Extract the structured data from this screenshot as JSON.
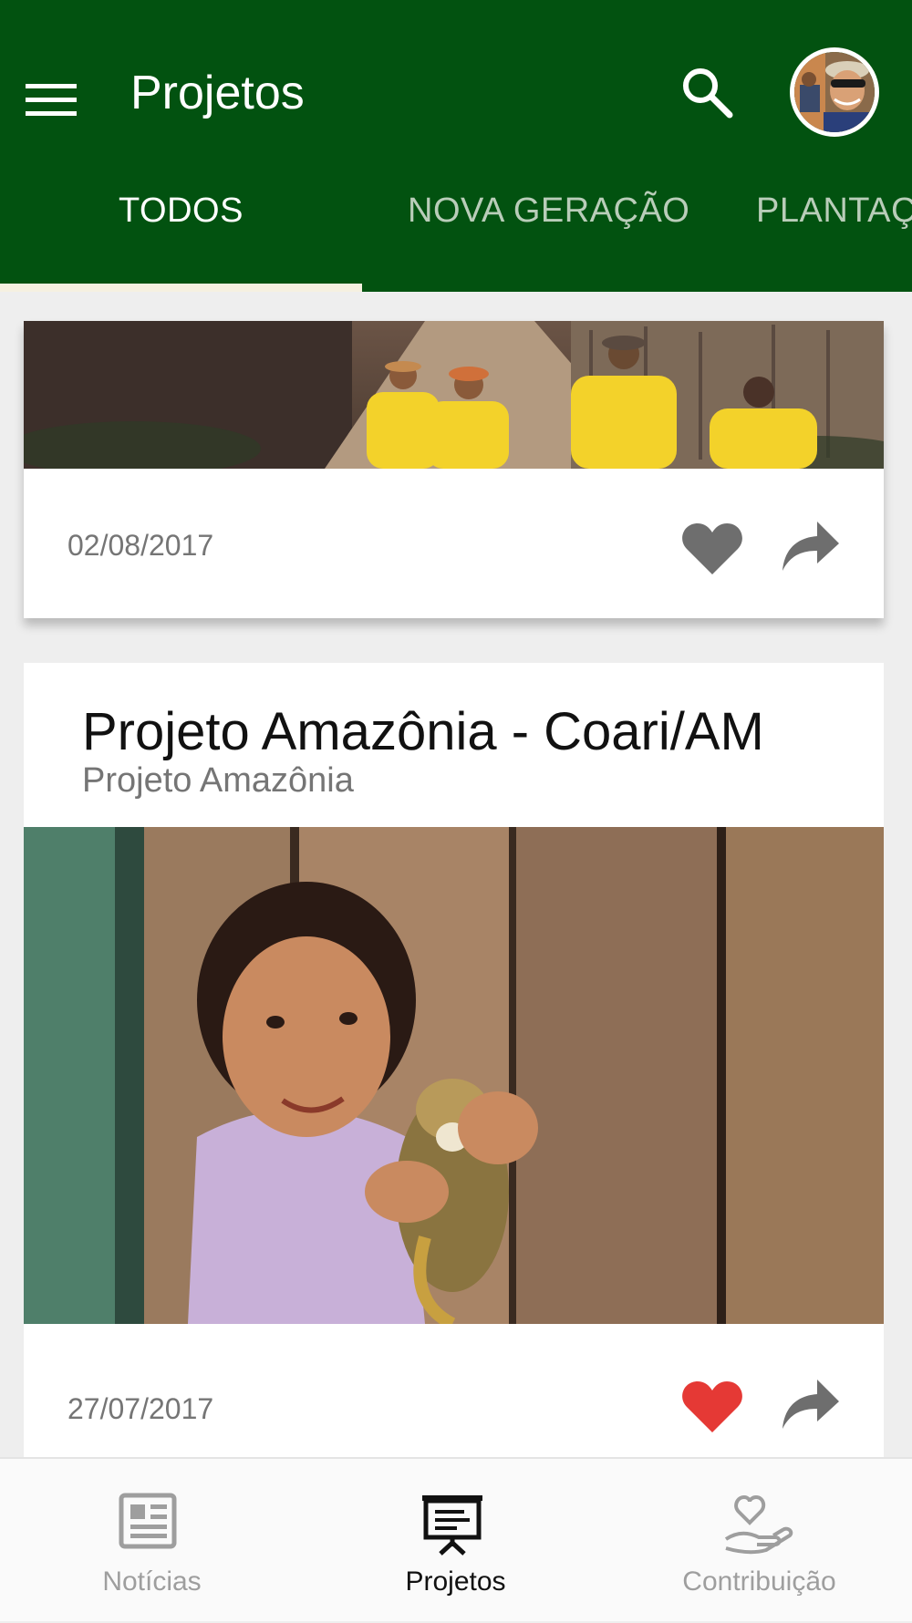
{
  "app_bar": {
    "title": "Projetos",
    "background": "#025210",
    "menu_icon": "hamburger-menu-icon",
    "search_icon": "search-icon",
    "avatar_icon": "user-avatar"
  },
  "tabs": [
    {
      "label": "TODOS",
      "active": true
    },
    {
      "label": "NOVA GERAÇÃO",
      "active": false
    },
    {
      "label": "PLANTAÇ",
      "active": false
    }
  ],
  "cards": [
    {
      "image": "volunteers-walking-photo",
      "date": "02/08/2017",
      "liked": false,
      "heart_color": "#6e6e6e"
    },
    {
      "title": "Projeto Amazônia - Coari/AM",
      "subtitle": "Projeto Amazônia",
      "image": "girl-with-monkey-photo",
      "date": "27/07/2017",
      "liked": true,
      "heart_color": "#e53935"
    }
  ],
  "bottom_nav": [
    {
      "label": "Notícias",
      "icon": "newspaper-icon",
      "active": false
    },
    {
      "label": "Projetos",
      "icon": "presentation-board-icon",
      "active": true
    },
    {
      "label": "Contribuição",
      "icon": "heart-in-hand-icon",
      "active": false
    }
  ]
}
